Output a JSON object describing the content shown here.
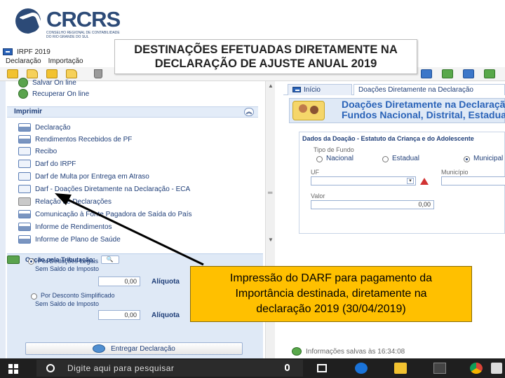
{
  "logo": {
    "text": "CRCRS",
    "subtitle": "CONSELHO REGIONAL DE CONTABILIDADE DO RIO GRANDE DO SUL"
  },
  "app": {
    "title": "IRPF 2019",
    "menu": [
      "Declaração",
      "Importação"
    ]
  },
  "banner": {
    "line1": "DESTINAÇÕES EFETUADAS DIRETAMENTE NA",
    "line2": "DECLARAÇÃO DE AJUSTE ANUAL 2019"
  },
  "sidebar": {
    "top_items": [
      "Salvar On line",
      "Recuperar On line"
    ],
    "section_title": "Imprimir",
    "print_items": [
      "Declaração",
      "Rendimentos Recebidos de PF",
      "Recibo",
      "Darf do IRPF",
      "Darf de Multa por Entrega em Atraso",
      "Darf - Doações Diretamente na Declaração - ECA",
      "Relação de Declarações",
      "Comunicação à Fonte Pagadora de Saída do País",
      "Informe de Rendimentos",
      "Informe de Plano de Saúde"
    ]
  },
  "tributacao": {
    "title": "Opção pela Tributação:",
    "option1": "Por Deduções Legais",
    "option1_sub": "Sem Saldo de Imposto",
    "option1_value": "0,00",
    "option2": "Por Desconto Simplificado",
    "option2_sub": "Sem Saldo de Imposto",
    "option2_value": "0,00",
    "aliquota_label": "Alíquota",
    "entregar_label": "Entregar Declaração"
  },
  "right": {
    "tab_home": "Início",
    "tab_active": "Doações Diretamente na Declaração",
    "header_line1": "Doações Diretamente na Declaração",
    "header_line2": "Fundos Nacional, Distrital, Estaduais e Municipais",
    "form_title": "Dados da Doação - Estatuto da Criança e do Adolescente",
    "tipo_fundo_label": "Tipo de Fundo",
    "fundo_options": [
      "Nacional",
      "Estadual",
      "Municipal"
    ],
    "uf_label": "UF",
    "municipio_label": "Município",
    "valor_label": "Valor",
    "valor_value": "0,00",
    "status_text": "Informações salvas às 16:34:08"
  },
  "callout": {
    "line1": "Impressão do DARF para pagamento da",
    "line2": "Importância destinada, diretamente na",
    "line3": "declaração 2019 (30/04/2019)"
  },
  "taskbar": {
    "search_placeholder": "Digite aqui para pesquisar"
  },
  "colors": {
    "callout_bg": "#ffc000",
    "brand_blue": "#2c4a77",
    "link_blue": "#1f3e78"
  }
}
